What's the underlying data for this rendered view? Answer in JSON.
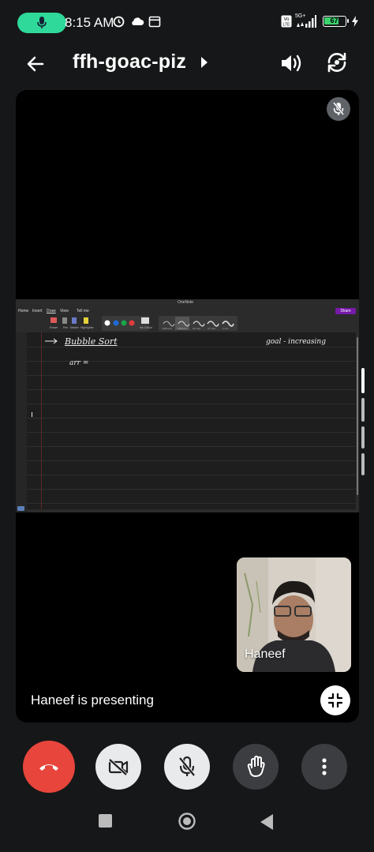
{
  "status_bar": {
    "time": "8:15 AM",
    "network_label": "5G+",
    "volte_label": "Vo LTE",
    "battery_percent": "67",
    "mic_active_color": "#2fd99a"
  },
  "header": {
    "meeting_code": "ffh-goac-piz",
    "icons": [
      "back-arrow-icon",
      "chevron-right-icon",
      "speaker-icon",
      "camera-switch-icon"
    ]
  },
  "shared_screen": {
    "app_title": "OneNote",
    "menu_tabs": [
      "Home",
      "Insert",
      "Draw",
      "View",
      "Tell me"
    ],
    "share_label": "Share",
    "ribbon_labels": [
      "Eraser",
      "Pen",
      "Marker",
      "Highlighter",
      "Ink Colour"
    ],
    "pen_sizes": [
      "0.25 mm",
      "0.35 mm",
      "0.5 mm",
      "0.7 mm",
      "1 mm"
    ],
    "ink_colors": [
      "#ffffff",
      "#1e6bd6",
      "#1aa34a",
      "#e23b3b"
    ],
    "note_lines": {
      "heading": "Bubble Sort",
      "goal": "goal - increasing",
      "line2": "arr ="
    }
  },
  "participant": {
    "name": "Haneef"
  },
  "presenting_text": "Haneef is presenting",
  "controls": {
    "end_call_color": "#e8453c",
    "items": [
      "end-call",
      "camera-off",
      "mic-off",
      "raise-hand",
      "more-options"
    ]
  }
}
